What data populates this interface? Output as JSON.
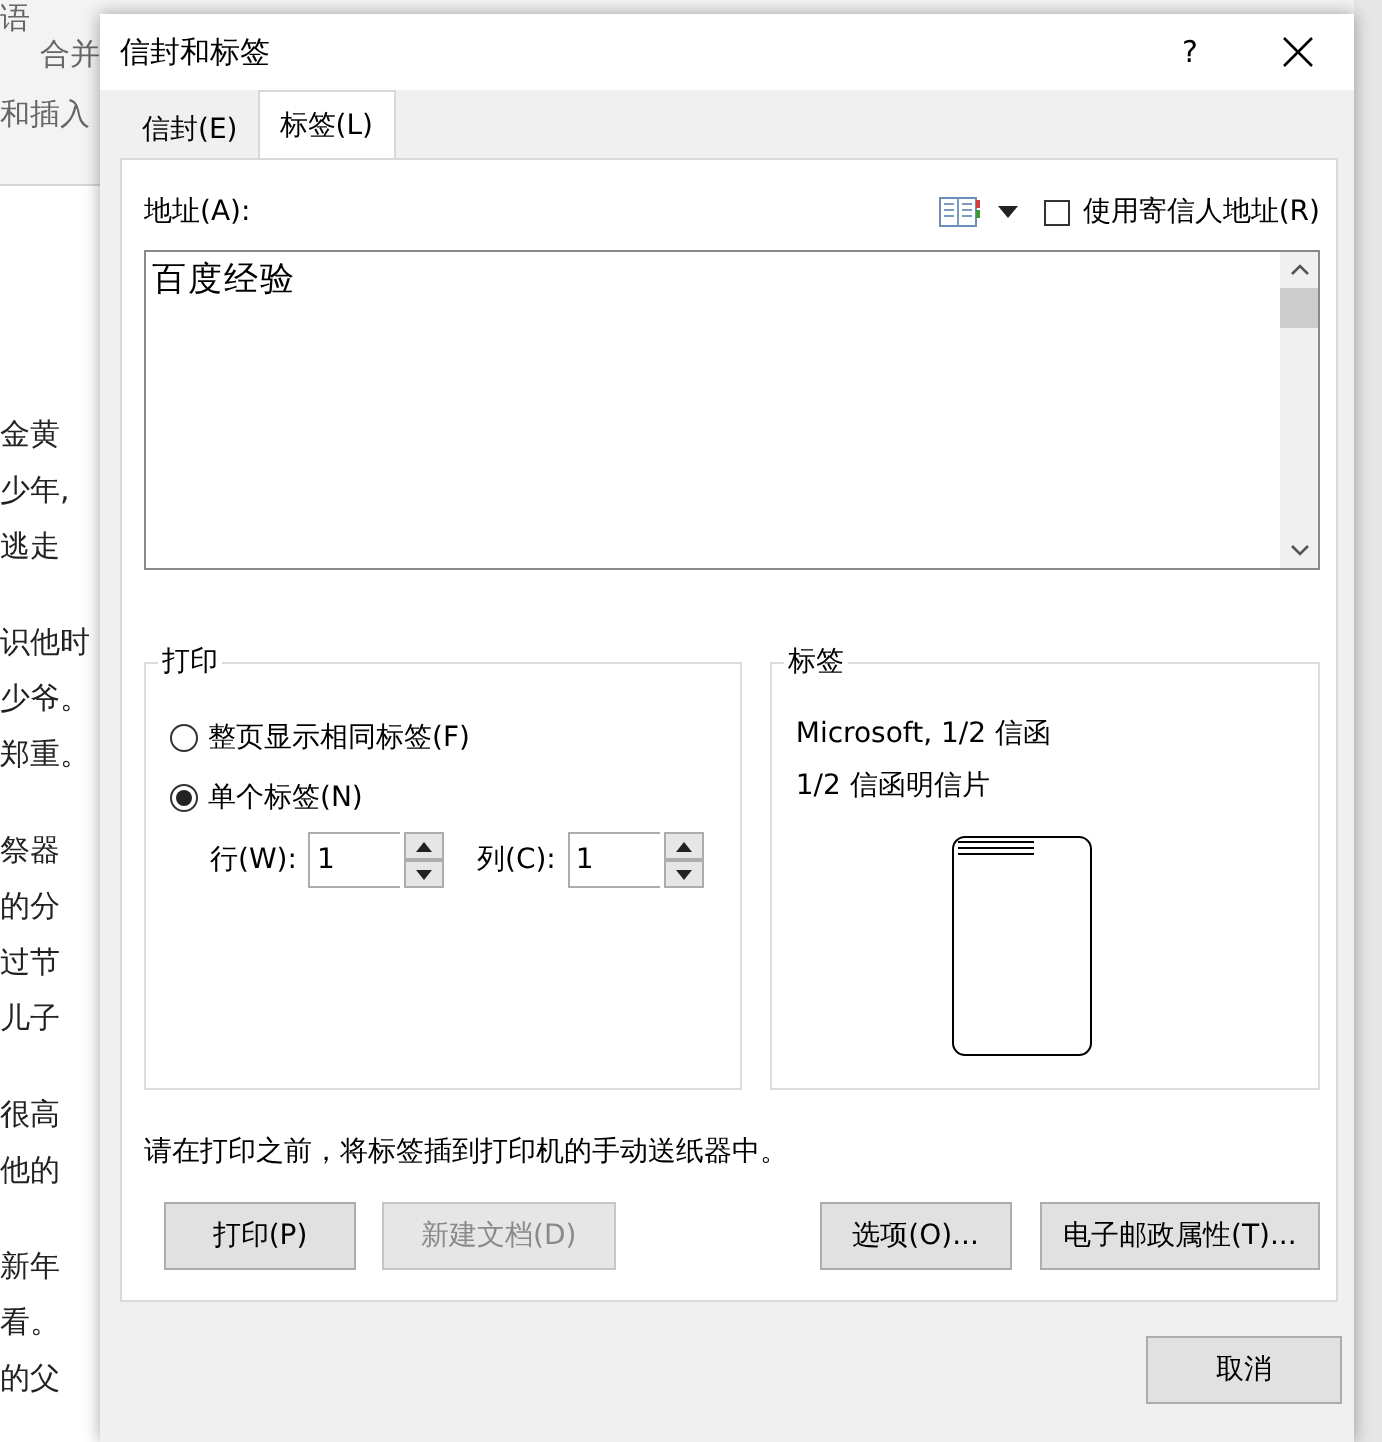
{
  "background": {
    "ribbon_texts": [
      "语",
      "合并",
      "和插入"
    ],
    "doc_lines": [
      "金黄",
      "少年,",
      "逃走",
      "识他时",
      "少爷。",
      "郑重。",
      "祭器",
      "的分",
      "过节",
      "儿子",
      "很高",
      "他的",
      "新年",
      "看。",
      "的父"
    ]
  },
  "dialog": {
    "title": "信封和标签",
    "help": "?",
    "tabs": [
      {
        "label": "信封(E)",
        "selected": false
      },
      {
        "label": "标签(L)",
        "selected": true
      }
    ],
    "address": {
      "label": "地址(A):",
      "value": "百度经验"
    },
    "return_address": {
      "label": "使用寄信人地址(R)",
      "checked": false
    },
    "print": {
      "title": "打印",
      "options": [
        {
          "label": "整页显示相同标签(F)",
          "selected": false
        },
        {
          "label": "单个标签(N)",
          "selected": true
        }
      ],
      "row": {
        "label": "行(W):",
        "value": "1"
      },
      "column": {
        "label": "列(C):",
        "value": "1"
      }
    },
    "label_info": {
      "title": "标签",
      "lines": [
        "Microsoft, 1/2 信函",
        "1/2 信函明信片"
      ]
    },
    "note": "请在打印之前，将标签插到打印机的手动送纸器中。",
    "buttons": [
      {
        "label": "打印(P)",
        "disabled": false
      },
      {
        "label": "新建文档(D)",
        "disabled": true
      },
      {
        "label": "选项(O)...",
        "disabled": false
      },
      {
        "label": "电子邮政属性(T)...",
        "disabled": false
      }
    ],
    "cancel": "取消"
  }
}
